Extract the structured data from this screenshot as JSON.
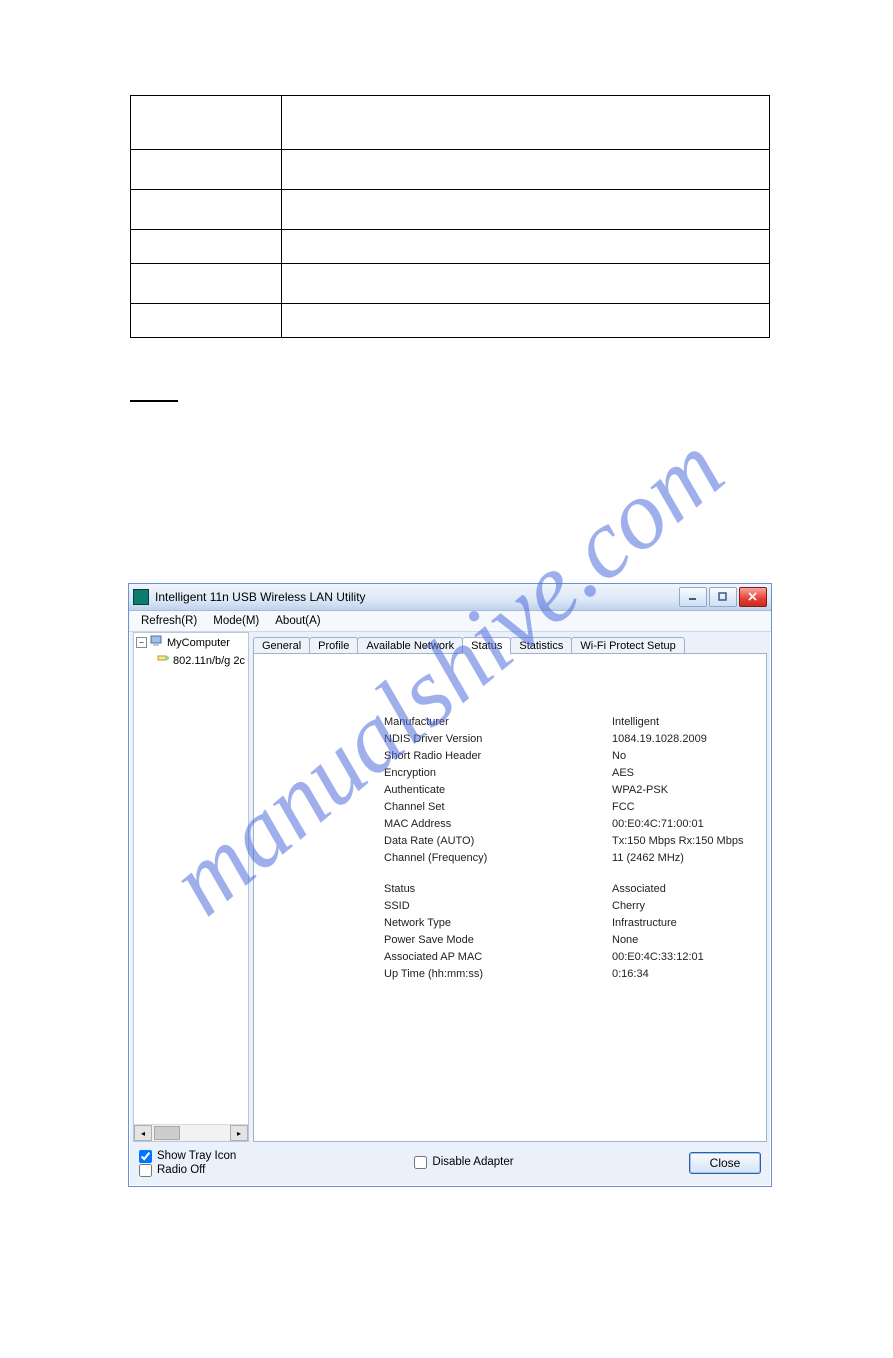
{
  "watermark": "manualshive.com",
  "window": {
    "title": "Intelligent 11n USB Wireless LAN Utility",
    "menubar": [
      "Refresh(R)",
      "Mode(M)",
      "About(A)"
    ],
    "tree": {
      "root": "MyComputer",
      "child": "802.11n/b/g 2c"
    },
    "tabs": [
      "General",
      "Profile",
      "Available Network",
      "Status",
      "Statistics",
      "Wi-Fi Protect Setup"
    ],
    "activeTab": "Status",
    "status": {
      "block1": [
        {
          "label": "Manufacturer",
          "value": "Intelligent"
        },
        {
          "label": "NDIS Driver Version",
          "value": "1084.19.1028.2009"
        },
        {
          "label": "Short Radio Header",
          "value": "No"
        },
        {
          "label": "Encryption",
          "value": "AES"
        },
        {
          "label": "Authenticate",
          "value": "WPA2-PSK"
        },
        {
          "label": "Channel Set",
          "value": "FCC"
        },
        {
          "label": "MAC Address",
          "value": "00:E0:4C:71:00:01"
        },
        {
          "label": "Data Rate (AUTO)",
          "value": "Tx:150 Mbps Rx:150 Mbps"
        },
        {
          "label": "Channel (Frequency)",
          "value": "11 (2462 MHz)"
        }
      ],
      "block2": [
        {
          "label": "Status",
          "value": "Associated"
        },
        {
          "label": "SSID",
          "value": "Cherry"
        },
        {
          "label": "Network Type",
          "value": "Infrastructure"
        },
        {
          "label": "Power Save Mode",
          "value": "None"
        },
        {
          "label": "Associated AP MAC",
          "value": "00:E0:4C:33:12:01"
        },
        {
          "label": "Up Time (hh:mm:ss)",
          "value": "0:16:34"
        }
      ]
    },
    "footer": {
      "showTray": "Show Tray Icon",
      "radioOff": "Radio Off",
      "disable": "Disable Adapter",
      "close": "Close"
    }
  },
  "tableRows": 6
}
